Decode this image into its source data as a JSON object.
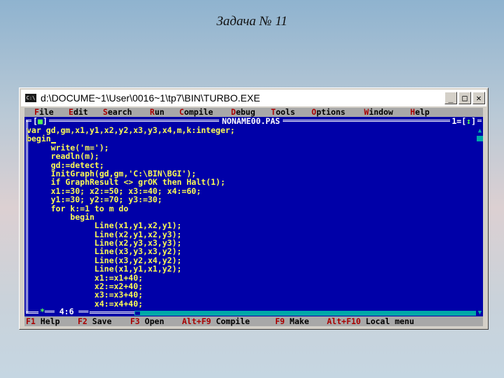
{
  "slide": {
    "title": "Задача № 11"
  },
  "window": {
    "title": "d:\\DOCUME~1\\User\\0016~1\\tp7\\BIN\\TURBO.EXE",
    "app_icon": "C:\\",
    "minimize": "_",
    "maximize": "□",
    "close": "✕"
  },
  "menu": {
    "items": [
      {
        "hot": "F",
        "rest": "ile"
      },
      {
        "hot": "E",
        "rest": "dit"
      },
      {
        "hot": "S",
        "rest": "earch"
      },
      {
        "hot": "R",
        "rest": "un"
      },
      {
        "hot": "C",
        "rest": "ompile"
      },
      {
        "hot": "D",
        "rest": "ebug"
      },
      {
        "hot": "T",
        "rest": "ools"
      },
      {
        "hot": "O",
        "rest": "ptions"
      },
      {
        "hot": "W",
        "rest": "indow"
      },
      {
        "hot": "H",
        "rest": "elp"
      }
    ]
  },
  "editor": {
    "filename": "NONAME00.PAS",
    "close_box": "■",
    "window_number": "1",
    "zoom_box": "↕",
    "cursor_position": "4:6",
    "modified_mark": "*",
    "lines": [
      "var gd,gm,x1,y1,x2,y2,x3,y3,x4,m,k:integer;",
      "begin",
      "     write('m=');",
      "     readln(m);",
      "     gd:=detect;",
      "     InitGraph(gd,gm,'C:\\BIN\\BGI');",
      "     if GraphResult <> grOK then Halt(1);",
      "     x1:=30; x2:=50; x3:=40; x4:=60;",
      "     y1:=30; y2:=70; y3:=30;",
      "     for k:=1 to m do",
      "         begin",
      "              Line(x1,y1,x2,y1);",
      "              Line(x2,y1,x2,y3);",
      "              Line(x2,y3,x3,y3);",
      "              Line(x3,y3,x3,y2);",
      "              Line(x3,y2,x4,y2);",
      "              Line(x1,y1,x1,y2);",
      "              x1:=x1+40;",
      "              x2:=x2+40;",
      "              x3:=x3+40;",
      "              x4:=x4+40;"
    ]
  },
  "statusbar": {
    "items": [
      {
        "key": "F1",
        "label": "Help"
      },
      {
        "key": "F2",
        "label": "Save"
      },
      {
        "key": "F3",
        "label": "Open"
      },
      {
        "key": "Alt+F9",
        "label": "Compile"
      },
      {
        "key": "F9",
        "label": "Make"
      },
      {
        "key": "Alt+F10",
        "label": "Local menu"
      }
    ]
  }
}
